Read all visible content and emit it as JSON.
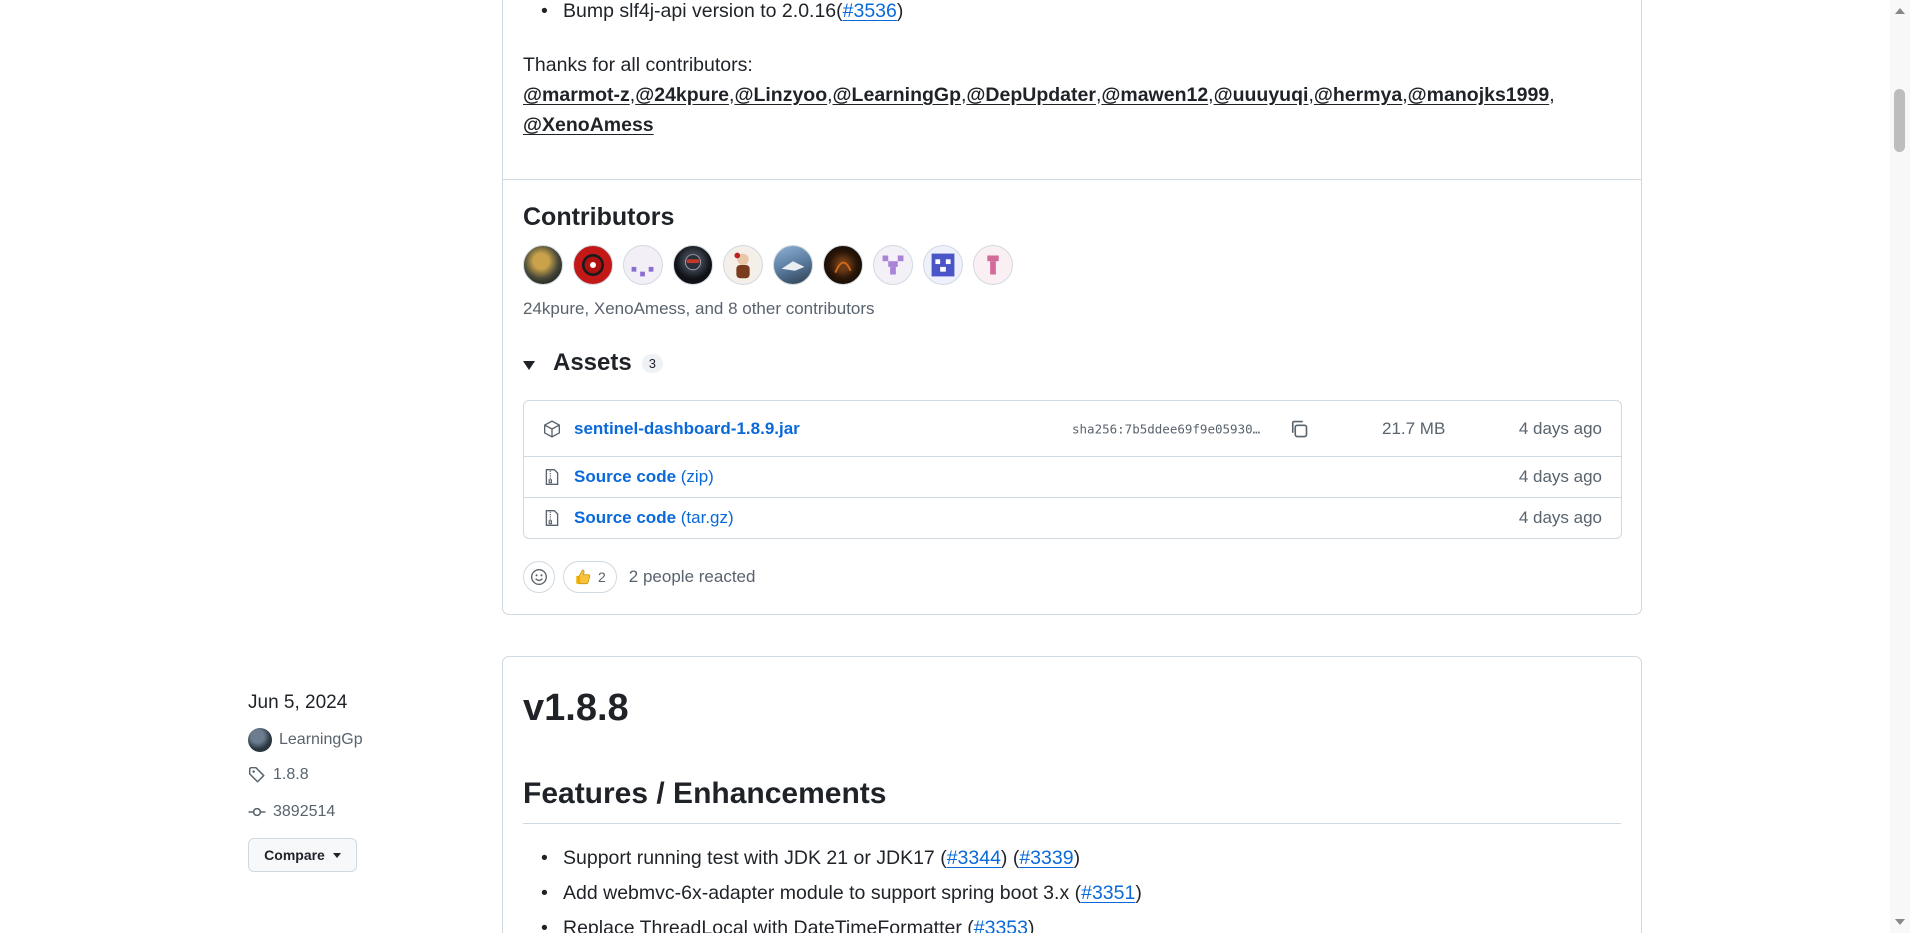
{
  "release_prev": {
    "last_bullet": {
      "text": "Bump slf4j-api version to 2.0.16(",
      "pr": "#3536",
      "close": ")"
    },
    "thanks_text": "Thanks for all contributors:",
    "thanks_users": [
      "@marmot-z",
      "@24kpure",
      "@Linzyoo",
      "@LearningGp",
      "@DepUpdater",
      "@mawen12",
      "@uuuyuqi",
      "@hermya",
      "@manojks1999",
      "@XenoAmess"
    ],
    "contributors_title": "Contributors",
    "contributors_summary": "24kpure, XenoAmess, and 8 other contributors",
    "assets_title": "Assets",
    "assets_count": "3",
    "assets": [
      {
        "name": "sentinel-dashboard-1.8.9.jar",
        "ext": "",
        "sha": "sha256:7b5ddee69f9e05930…",
        "size": "21.7 MB",
        "date": "4 days ago",
        "icon": "package-icon"
      },
      {
        "name": "Source code",
        "ext": " (zip)",
        "sha": "",
        "size": "",
        "date": "4 days ago",
        "icon": "file-zip-icon"
      },
      {
        "name": "Source code",
        "ext": " (tar.gz)",
        "sha": "",
        "size": "",
        "date": "4 days ago",
        "icon": "file-zip-icon"
      }
    ],
    "reaction_count": "2",
    "reaction_text": "2 people reacted"
  },
  "release_next": {
    "date": "Jun 5, 2024",
    "author": "LearningGp",
    "tag": "1.8.8",
    "commit": "3892514",
    "compare_label": "Compare",
    "title": "v1.8.8",
    "section": "Features / Enhancements",
    "items": [
      {
        "text": "Support running test with JDK 21 or JDK17 (",
        "pr1": "#3344",
        "mid": ") (",
        "pr2": "#3339",
        "end": ")"
      },
      {
        "text": "Add webmvc-6x-adapter module to support spring boot 3.x (",
        "pr1": "#3351",
        "end": ")"
      },
      {
        "text": "Replace ThreadLocal with DateTimeFormatter (",
        "pr1": "#3353",
        "end": ")"
      }
    ]
  },
  "colors": {
    "link": "#0969da",
    "border": "#d1d9e0",
    "muted": "#59636e"
  }
}
